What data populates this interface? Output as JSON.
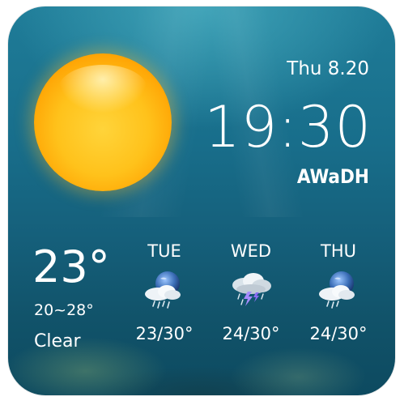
{
  "date": "Thu 8.20",
  "time": "19:30",
  "location": "AWaDH",
  "current": {
    "temperature": "23°",
    "range": "20~28°",
    "condition": "Clear",
    "icon": "sun-icon"
  },
  "forecast": [
    {
      "day": "TUE",
      "temps": "23/30°",
      "icon": "rain-showers-icon"
    },
    {
      "day": "WED",
      "temps": "24/30°",
      "icon": "thunderstorm-icon"
    },
    {
      "day": "THU",
      "temps": "24/30°",
      "icon": "rain-showers-icon"
    }
  ],
  "colors": {
    "background": "#186e8b",
    "sun": "#ffc21b",
    "text": "#ffffff"
  }
}
